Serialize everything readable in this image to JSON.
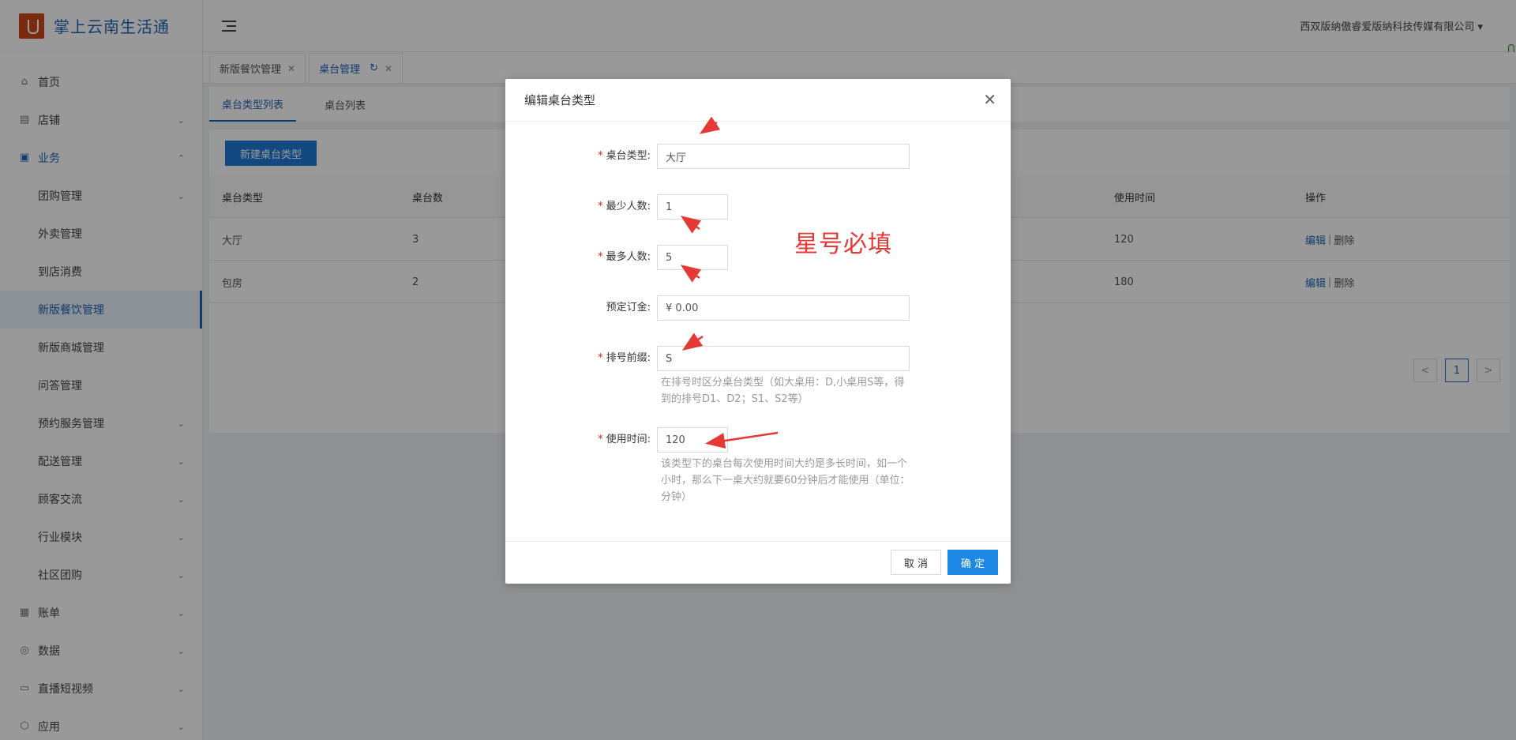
{
  "app": {
    "title": "掌上云南生活通"
  },
  "header": {
    "user": "西双版纳傲睿爱版纳科技传媒有限公司"
  },
  "sidebar": {
    "items": [
      {
        "label": "首页",
        "icon": "home-icon"
      },
      {
        "label": "店铺",
        "icon": "shop-icon"
      },
      {
        "label": "业务",
        "icon": "business-icon"
      },
      {
        "label": "团购管理"
      },
      {
        "label": "外卖管理"
      },
      {
        "label": "到店消费"
      },
      {
        "label": "新版餐饮管理"
      },
      {
        "label": "新版商城管理"
      },
      {
        "label": "问答管理"
      },
      {
        "label": "预约服务管理"
      },
      {
        "label": "配送管理"
      },
      {
        "label": "顾客交流"
      },
      {
        "label": "行业模块"
      },
      {
        "label": "社区团购"
      },
      {
        "label": "账单",
        "icon": "bill-icon"
      },
      {
        "label": "数据",
        "icon": "data-icon"
      },
      {
        "label": "直播短视频",
        "icon": "live-icon"
      },
      {
        "label": "应用",
        "icon": "app-icon"
      }
    ]
  },
  "tabs": [
    {
      "label": "新版餐饮管理"
    },
    {
      "label": "桌台管理"
    }
  ],
  "subtabs": [
    {
      "label": "桌台类型列表"
    },
    {
      "label": "桌台列表"
    }
  ],
  "toolbar": {
    "new_label": "新建桌台类型"
  },
  "table": {
    "headers": {
      "type": "桌台类型",
      "count": "桌台数",
      "time": "使用时间",
      "ops": "操作"
    },
    "rows": [
      {
        "type": "大厅",
        "count": "3",
        "time": "120",
        "edit": "编辑",
        "delete": "删除"
      },
      {
        "type": "包房",
        "count": "2",
        "time": "180",
        "edit": "编辑",
        "delete": "删除"
      }
    ],
    "sep": "|"
  },
  "pager": {
    "prev": "<",
    "page": "1",
    "next": ">"
  },
  "modal": {
    "title": "编辑桌台类型",
    "required_mark": "*",
    "fields": {
      "type": {
        "label": "桌台类型:",
        "value": "大厅"
      },
      "min": {
        "label": "最少人数:",
        "value": "1"
      },
      "max": {
        "label": "最多人数:",
        "value": "5"
      },
      "deposit": {
        "label": "预定订金:",
        "value": "¥ 0.00"
      },
      "prefix": {
        "label": "排号前缀:",
        "value": "S",
        "help": "在排号时区分桌台类型（如大桌用：D,小桌用S等，得到的排号D1、D2；S1、S2等）"
      },
      "time": {
        "label": "使用时间:",
        "value": "120",
        "help": "该类型下的桌台每次使用时间大约是多长时间，如一个小时，那么下一桌大约就要60分钟后才能使用（单位：分钟）"
      }
    },
    "cancel_label": "取 消",
    "ok_label": "确 定"
  },
  "annotation": {
    "text": "星号必填",
    "color": "#e53935"
  },
  "colors": {
    "accent": "#1f63b5",
    "primary_button": "#1e88e5",
    "required": "#e02020"
  }
}
